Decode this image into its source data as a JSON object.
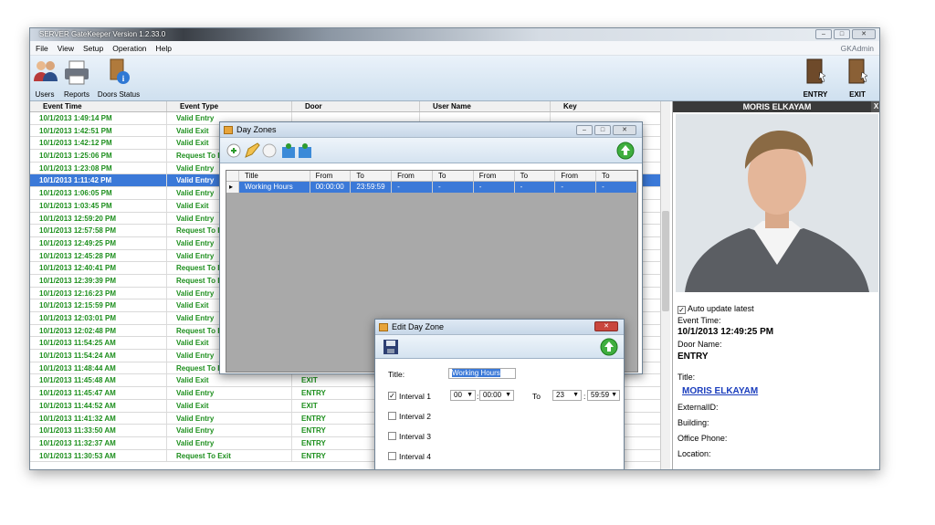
{
  "window": {
    "title": "SERVER GateKeeper Version 1.2.33.0",
    "user": "GKAdmin"
  },
  "menu": [
    "File",
    "View",
    "Setup",
    "Operation",
    "Help"
  ],
  "toolbar": {
    "users": "Users",
    "reports": "Reports",
    "doors_status": "Doors Status",
    "entry": "ENTRY",
    "exit": "EXIT"
  },
  "grid": {
    "columns": [
      "Event Time",
      "Event Type",
      "Door",
      "User Name",
      "Key"
    ],
    "rows": [
      [
        "10/1/2013 1:49:14 PM",
        "Valid Entry"
      ],
      [
        "10/1/2013 1:42:51 PM",
        "Valid Exit"
      ],
      [
        "10/1/2013 1:42:12 PM",
        "Valid Exit"
      ],
      [
        "10/1/2013 1:25:06 PM",
        "Request To Exit"
      ],
      [
        "10/1/2013 1:23:08 PM",
        "Valid Entry"
      ],
      [
        "10/1/2013 1:11:42 PM",
        "Valid Entry"
      ],
      [
        "10/1/2013 1:06:05 PM",
        "Valid Entry"
      ],
      [
        "10/1/2013 1:03:45 PM",
        "Valid Exit"
      ],
      [
        "10/1/2013 12:59:20 PM",
        "Valid Entry"
      ],
      [
        "10/1/2013 12:57:58 PM",
        "Request To Exit"
      ],
      [
        "10/1/2013 12:49:25 PM",
        "Valid Entry"
      ],
      [
        "10/1/2013 12:45:28 PM",
        "Valid Entry"
      ],
      [
        "10/1/2013 12:40:41 PM",
        "Request To Exit"
      ],
      [
        "10/1/2013 12:39:39 PM",
        "Request To Exit"
      ],
      [
        "10/1/2013 12:16:23 PM",
        "Valid Entry"
      ],
      [
        "10/1/2013 12:15:59 PM",
        "Valid Exit"
      ],
      [
        "10/1/2013 12:03:01 PM",
        "Valid Entry"
      ],
      [
        "10/1/2013 12:02:48 PM",
        "Request To Exit"
      ],
      [
        "10/1/2013 11:54:25 AM",
        "Valid Exit",
        "EXIT"
      ],
      [
        "10/1/2013 11:54:24 AM",
        "Valid Entry",
        "ENTRY"
      ],
      [
        "10/1/2013 11:48:44 AM",
        "Request To Exit",
        "ENTRY"
      ],
      [
        "10/1/2013 11:45:48 AM",
        "Valid Exit",
        "EXIT"
      ],
      [
        "10/1/2013 11:45:47 AM",
        "Valid Entry",
        "ENTRY"
      ],
      [
        "10/1/2013 11:44:52 AM",
        "Valid Exit",
        "EXIT"
      ],
      [
        "10/1/2013 11:41:32 AM",
        "Valid Entry",
        "ENTRY"
      ],
      [
        "10/1/2013 11:33:50 AM",
        "Valid Entry",
        "ENTRY"
      ],
      [
        "10/1/2013 11:32:37 AM",
        "Valid Entry",
        "ENTRY"
      ],
      [
        "10/1/2013 11:30:53 AM",
        "Request To Exit",
        "ENTRY"
      ]
    ],
    "selected_index": 5
  },
  "right_panel": {
    "name": "MORIS ELKAYAM",
    "auto_update": "Auto update latest",
    "event_time_label": "Event Time:",
    "event_time": "10/1/2013 12:49:25 PM",
    "door_name_label": "Door Name:",
    "door_name": "ENTRY",
    "title_label": "Title:",
    "title_value": "MORIS ELKAYAM",
    "external_id_label": "ExternalID:",
    "building_label": "Building:",
    "office_phone_label": "Office Phone:",
    "location_label": "Location:"
  },
  "day_zones": {
    "title": "Day Zones",
    "columns": [
      "Title",
      "From",
      "To",
      "From",
      "To",
      "From",
      "To",
      "From",
      "To"
    ],
    "row": [
      "Working Hours",
      "00:00:00",
      "23:59:59",
      "-",
      "-",
      "-",
      "-",
      "-",
      "-"
    ]
  },
  "edit_day_zone": {
    "title": "Edit Day Zone",
    "title_label": "Title:",
    "title_value": "Working Hours",
    "interval1": "Interval 1",
    "interval2": "Interval 2",
    "interval3": "Interval 3",
    "interval4": "Interval 4",
    "from_hour": "00",
    "from_min": "00:00",
    "to_label": "To",
    "to_hour": "23",
    "to_min": "59:59"
  },
  "colors": {
    "accent": "#3b79d8",
    "event_text": "#1d8f1d"
  }
}
